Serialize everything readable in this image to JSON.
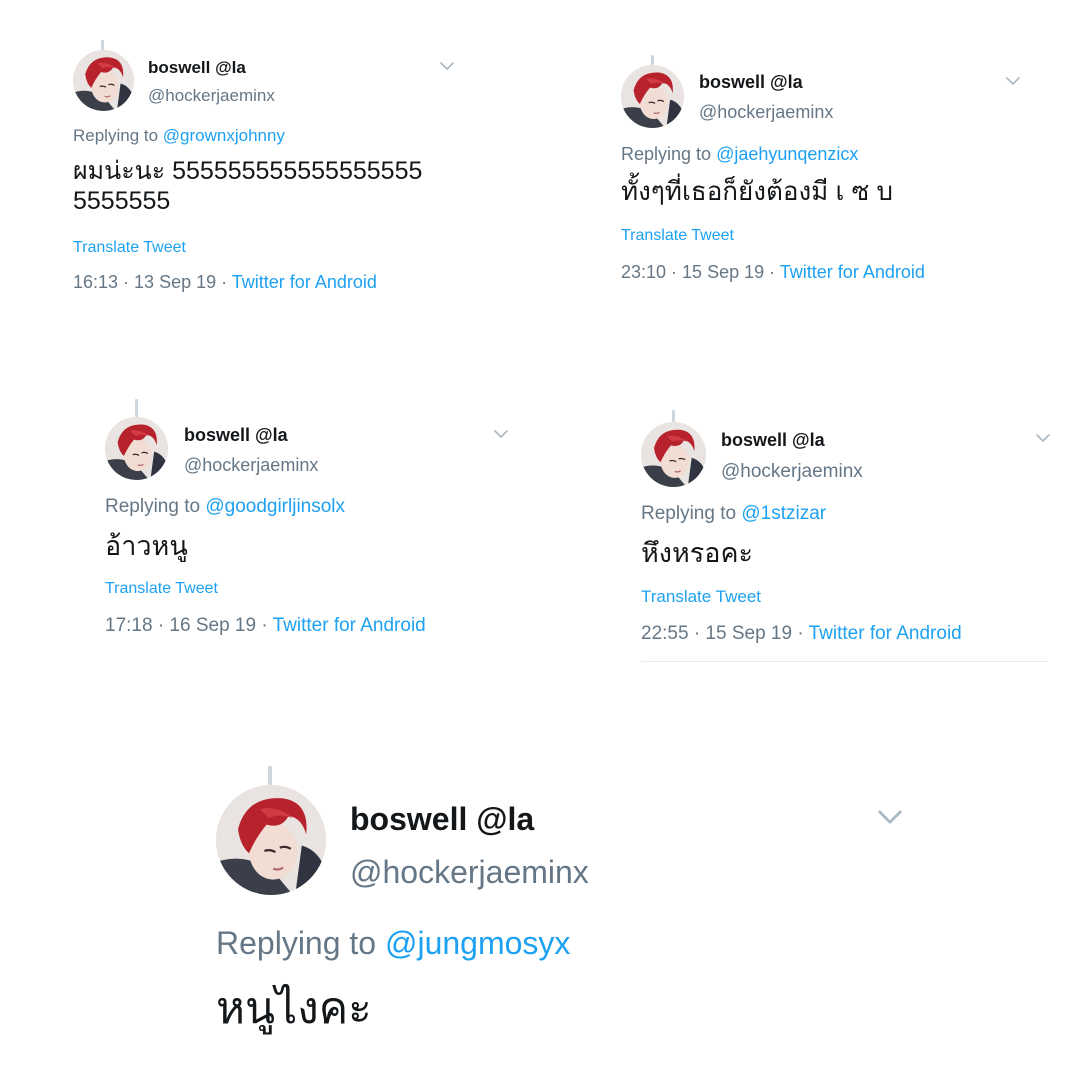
{
  "colors": {
    "text": "#14171a",
    "muted": "#657786",
    "link": "#1da1f2",
    "thread_line": "#ccd6dd",
    "background": "#ffffff"
  },
  "tweets": [
    {
      "display_name": "boswell @la",
      "handle": "@hockerjaeminx",
      "replying_prefix": "Replying to ",
      "replying_to": "@grownxjohnny",
      "text": "ผมน่ะนะ 555555555555555555 5555555",
      "translate_label": "Translate Tweet",
      "timestamp": "16:13 · 13 Sep 19 · ",
      "source": "Twitter for Android",
      "avatar_icon": "profile-avatar",
      "menu_icon": "chevron-down-icon"
    },
    {
      "display_name": "boswell @la",
      "handle": "@hockerjaeminx",
      "replying_prefix": "Replying to ",
      "replying_to": "@jaehyunqenzicx",
      "text": "ทั้งๆที่เธอก็ยังต้องมี เ ซ บ",
      "translate_label": "Translate Tweet",
      "timestamp": "23:10 · 15 Sep 19 · ",
      "source": "Twitter for Android",
      "avatar_icon": "profile-avatar",
      "menu_icon": "chevron-down-icon"
    },
    {
      "display_name": "boswell @la",
      "handle": "@hockerjaeminx",
      "replying_prefix": "Replying to ",
      "replying_to": "@goodgirljinsolx",
      "text": "อ้าวหนู",
      "translate_label": "Translate Tweet",
      "timestamp": "17:18 · 16 Sep 19 · ",
      "source": "Twitter for Android",
      "avatar_icon": "profile-avatar",
      "menu_icon": "chevron-down-icon"
    },
    {
      "display_name": "boswell @la",
      "handle": "@hockerjaeminx",
      "replying_prefix": "Replying to ",
      "replying_to": "@1stzizar",
      "text": "หึงหรอคะ",
      "translate_label": "Translate Tweet",
      "timestamp": "22:55 · 15 Sep 19 · ",
      "source": "Twitter for Android",
      "avatar_icon": "profile-avatar",
      "menu_icon": "chevron-down-icon"
    },
    {
      "display_name": "boswell @la",
      "handle": "@hockerjaeminx",
      "replying_prefix": "Replying to ",
      "replying_to": "@jungmosyx",
      "text": "หนูไงคะ",
      "avatar_icon": "profile-avatar",
      "menu_icon": "chevron-down-icon"
    }
  ]
}
